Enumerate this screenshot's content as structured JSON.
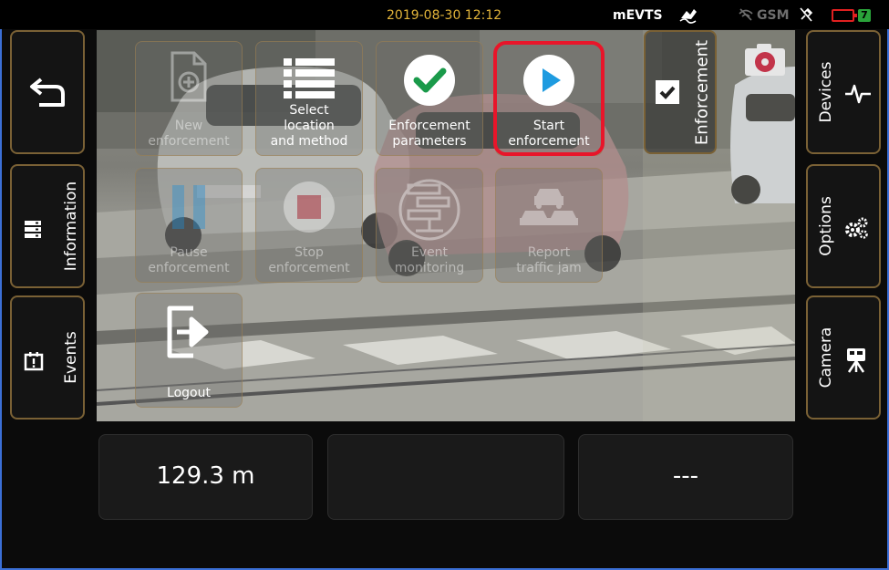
{
  "status_bar": {
    "datetime": "2019-08-30 12:12",
    "app_name": "mEVTS",
    "gsm_label": "GSM",
    "plug_label": "7",
    "icons": [
      "signed-icon",
      "no-signal-icon",
      "gps-off-icon",
      "battery-icon",
      "power-plug-icon"
    ]
  },
  "left_sidebar": {
    "back": {
      "icon": "back-arrow-icon"
    },
    "information": {
      "label": "Information",
      "icon": "server-list-icon"
    },
    "events": {
      "label": "Events",
      "icon": "calendar-alert-icon"
    }
  },
  "right_sidebar": {
    "devices": {
      "label": "Devices",
      "icon": "pulse-icon"
    },
    "options": {
      "label": "Options",
      "icon": "gears-icon"
    },
    "camera": {
      "label": "Camera",
      "icon": "camera-tripod-icon"
    }
  },
  "enforcement_panel": {
    "label": "Enforcement",
    "checked": true
  },
  "tiles": [
    {
      "label_lines": [
        "New",
        "enforcement"
      ],
      "icon": "new-document-icon",
      "enabled": false
    },
    {
      "label_lines": [
        "Select",
        "location",
        "and method"
      ],
      "icon": "list-icon",
      "enabled": true
    },
    {
      "label_lines": [
        "Enforcement",
        "parameters"
      ],
      "icon": "check-circle-icon",
      "enabled": true
    },
    {
      "label_lines": [
        "Start",
        "enforcement"
      ],
      "icon": "play-circle-icon",
      "enabled": true,
      "highlighted": true
    },
    {
      "label_lines": [
        "Pause",
        "enforcement"
      ],
      "icon": "pause-icon",
      "enabled": false
    },
    {
      "label_lines": [
        "Stop",
        "enforcement"
      ],
      "icon": "stop-circle-icon",
      "enabled": false
    },
    {
      "label_lines": [
        "Event",
        "monitoring"
      ],
      "icon": "monitoring-icon",
      "enabled": false
    },
    {
      "label_lines": [
        "Report",
        "traffic jam"
      ],
      "icon": "traffic-jam-icon",
      "enabled": false
    },
    {
      "label_lines": [
        "Logout"
      ],
      "icon": "logout-icon",
      "enabled": true
    }
  ],
  "info_boxes": [
    {
      "value": "129.3 m"
    },
    {
      "value": ""
    },
    {
      "value": "---"
    }
  ],
  "colors": {
    "accent_border": "#7a6135",
    "datetime": "#e2b43a",
    "highlight": "#e8152a",
    "check_green": "#1a9a4a",
    "play_blue": "#1e9be0",
    "stop_red": "#d0273a",
    "pause_blue": "#1f8fd6"
  }
}
